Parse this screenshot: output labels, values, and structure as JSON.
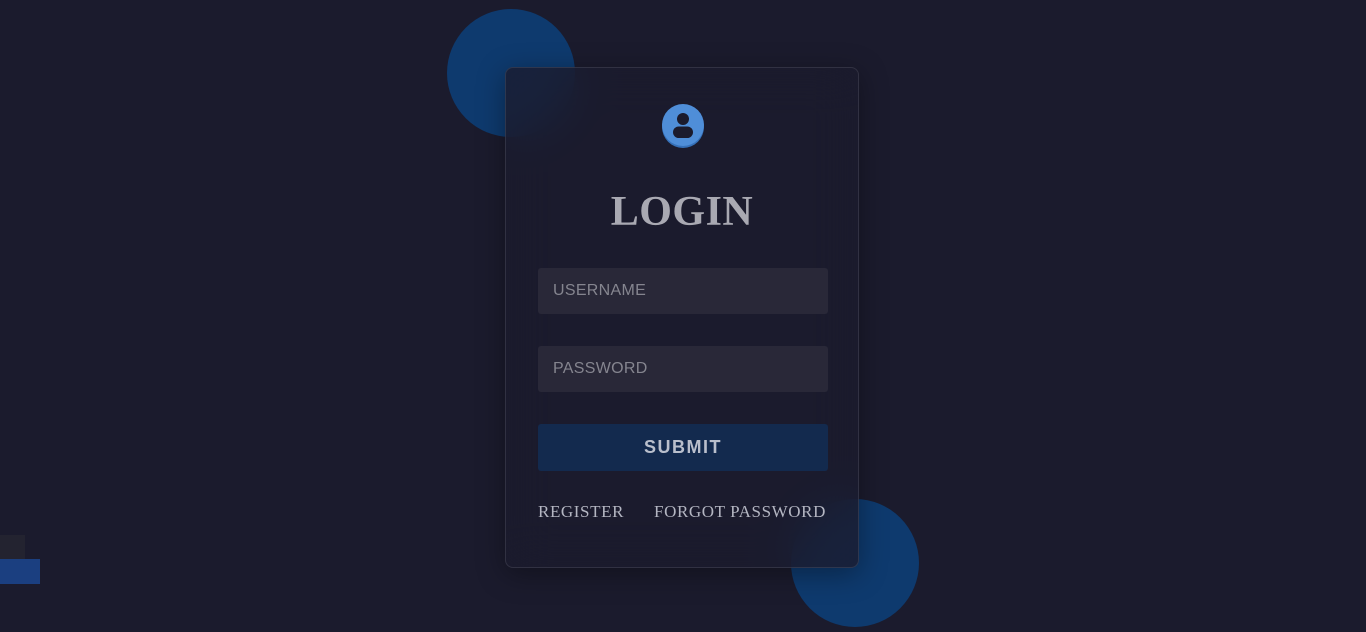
{
  "login": {
    "title": "LOGIN",
    "username_placeholder": "USERNAME",
    "password_placeholder": "PASSWORD",
    "submit_label": "SUBMIT",
    "register_label": "REGISTER",
    "forgot_label": "FORGOT PASSWORD",
    "avatar_icon": "user-circle-icon"
  },
  "colors": {
    "background": "#1b1b2d",
    "blob": "#0e3a6e",
    "avatar": "#4f8ed8",
    "submit_bg": "#132a4e",
    "field_bg": "#292838"
  }
}
